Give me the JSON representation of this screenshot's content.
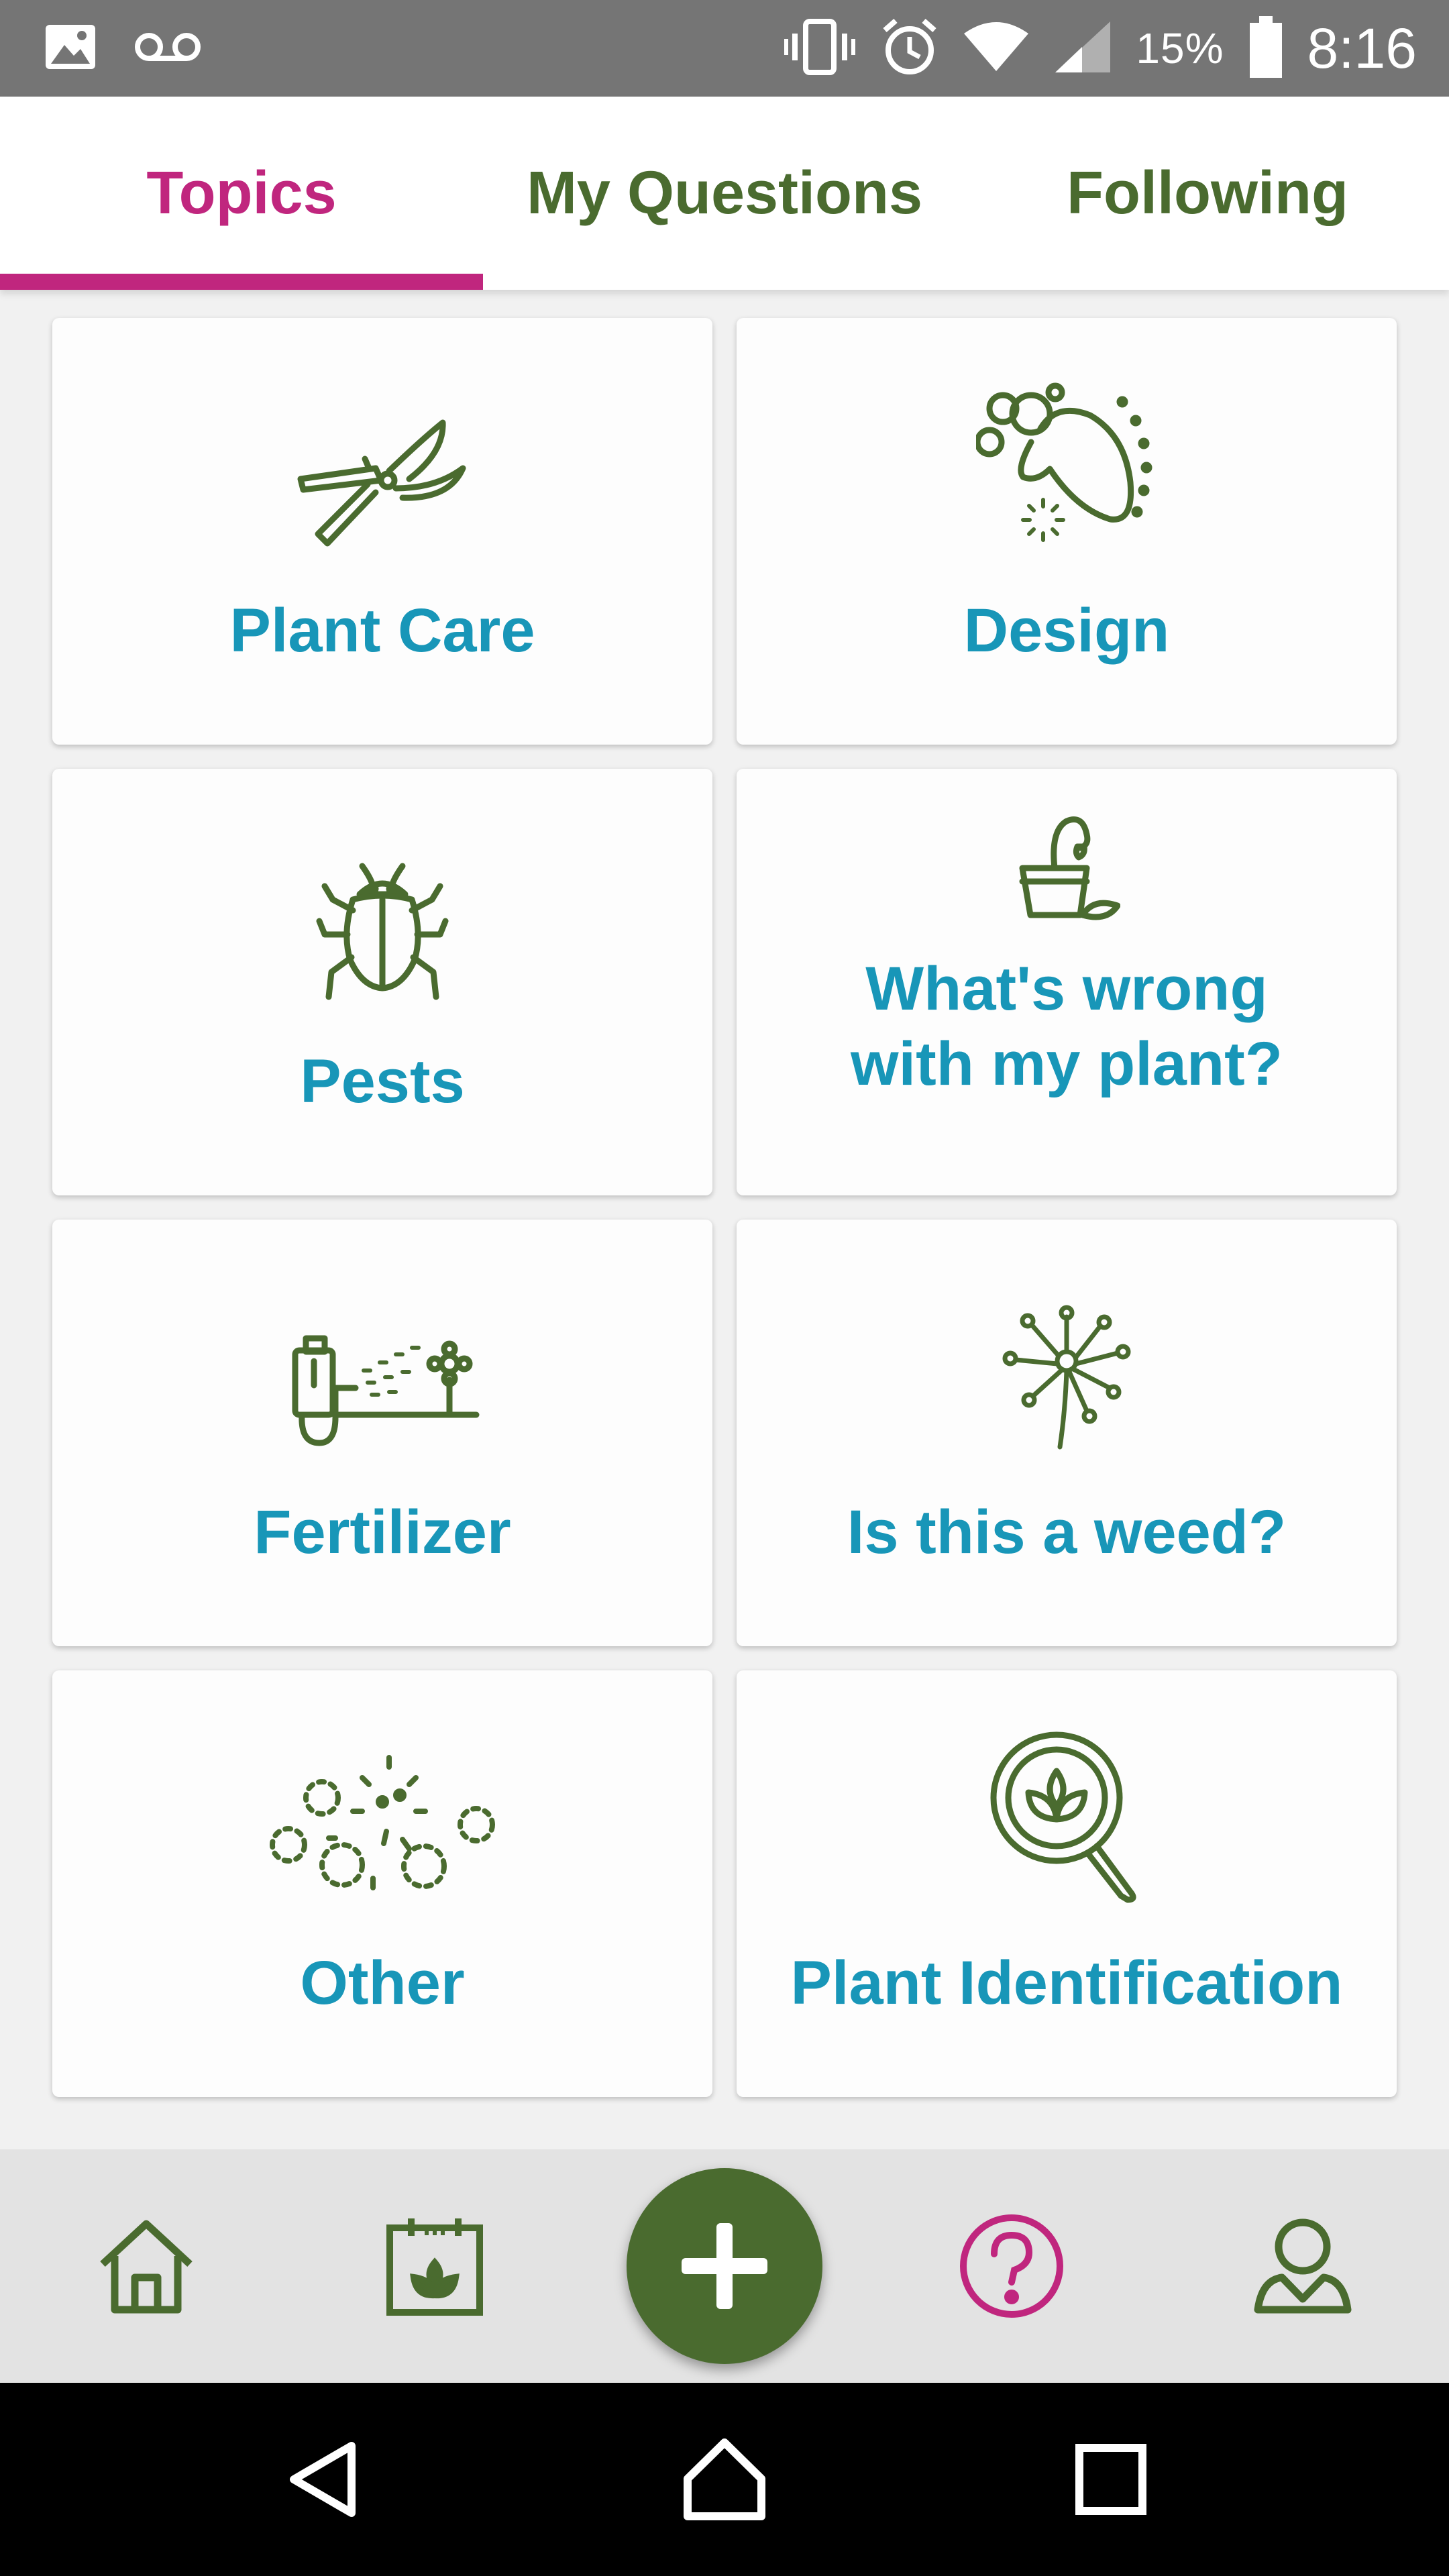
{
  "status_bar": {
    "battery_percent": "15%",
    "time": "8:16"
  },
  "tabs": [
    {
      "label": "Topics",
      "active": true
    },
    {
      "label": "My Questions",
      "active": false
    },
    {
      "label": "Following",
      "active": false
    }
  ],
  "topics": [
    {
      "label_lines": [
        "Plant Care"
      ],
      "icon": "pruning-shears-icon"
    },
    {
      "label_lines": [
        "Design"
      ],
      "icon": "garden-design-icon"
    },
    {
      "label_lines": [
        "Pests"
      ],
      "icon": "beetle-icon"
    },
    {
      "label_lines": [
        "What's wrong",
        "with my plant?"
      ],
      "icon": "wilting-plant-pot-icon"
    },
    {
      "label_lines": [
        "Fertilizer"
      ],
      "icon": "fertilizer-sprayer-icon"
    },
    {
      "label_lines": [
        "Is this a weed?"
      ],
      "icon": "dandelion-icon"
    },
    {
      "label_lines": [
        "Other"
      ],
      "icon": "seeds-scatter-icon"
    },
    {
      "label_lines": [
        "Plant Identification"
      ],
      "icon": "magnifier-leaf-icon"
    }
  ],
  "bottom_nav": [
    {
      "name": "home",
      "icon": "home-icon",
      "active": false
    },
    {
      "name": "garden-calendar",
      "icon": "plant-calendar-icon",
      "active": false
    },
    {
      "name": "add",
      "icon": "plus-icon",
      "active": false
    },
    {
      "name": "questions",
      "icon": "question-circle-icon",
      "active": true
    },
    {
      "name": "profile",
      "icon": "user-icon",
      "active": false
    }
  ],
  "colors": {
    "accent_green": "#4a6b2f",
    "label_blue": "#1896b8",
    "active_magenta": "#c0267e"
  }
}
